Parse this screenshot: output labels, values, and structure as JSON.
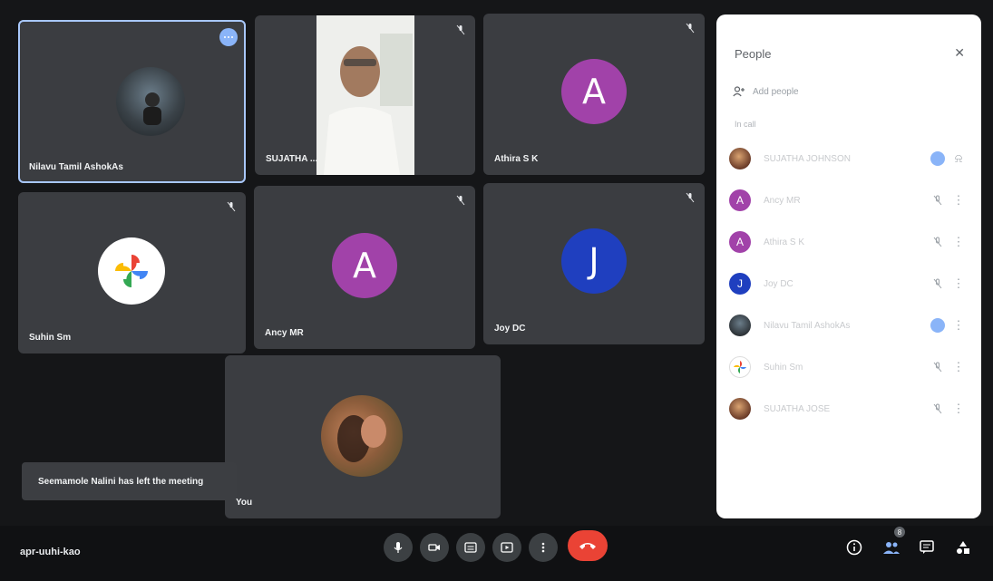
{
  "meeting": {
    "code": "apr-uuhi-kao"
  },
  "tiles": [
    {
      "name": "Nilavu Tamil AshokAs"
    },
    {
      "name": "SUJATHA ..."
    },
    {
      "name": "Athira S K",
      "initial": "A"
    },
    {
      "name": "Suhin Sm"
    },
    {
      "name": "Ancy MR",
      "initial": "A"
    },
    {
      "name": "Joy DC",
      "initial": "J"
    },
    {
      "name": "You"
    }
  ],
  "toast": {
    "text": "Seemamole Nalini has left the meeting"
  },
  "people_panel": {
    "title": "People",
    "add_people": "Add people",
    "section": "In call",
    "participants": [
      {
        "name": "SUJATHA JOHNSON",
        "initial": "",
        "status": "speaking"
      },
      {
        "name": "Ancy MR",
        "initial": "A",
        "status": "muted"
      },
      {
        "name": "Athira S K",
        "initial": "A",
        "status": "muted"
      },
      {
        "name": "Joy DC",
        "initial": "J",
        "status": "muted"
      },
      {
        "name": "Nilavu Tamil AshokAs",
        "initial": "",
        "status": "speaking"
      },
      {
        "name": "Suhin Sm",
        "initial": "",
        "status": "muted"
      },
      {
        "name": "SUJATHA JOSE",
        "initial": "",
        "status": "muted"
      }
    ]
  },
  "participant_count_badge": "8",
  "colors": {
    "tile": "#3b3d41",
    "avatar_purple": "#a142a9",
    "avatar_blue": "#1f3fbf",
    "hangup": "#ea4335",
    "speaking": "#8ab4f8"
  }
}
